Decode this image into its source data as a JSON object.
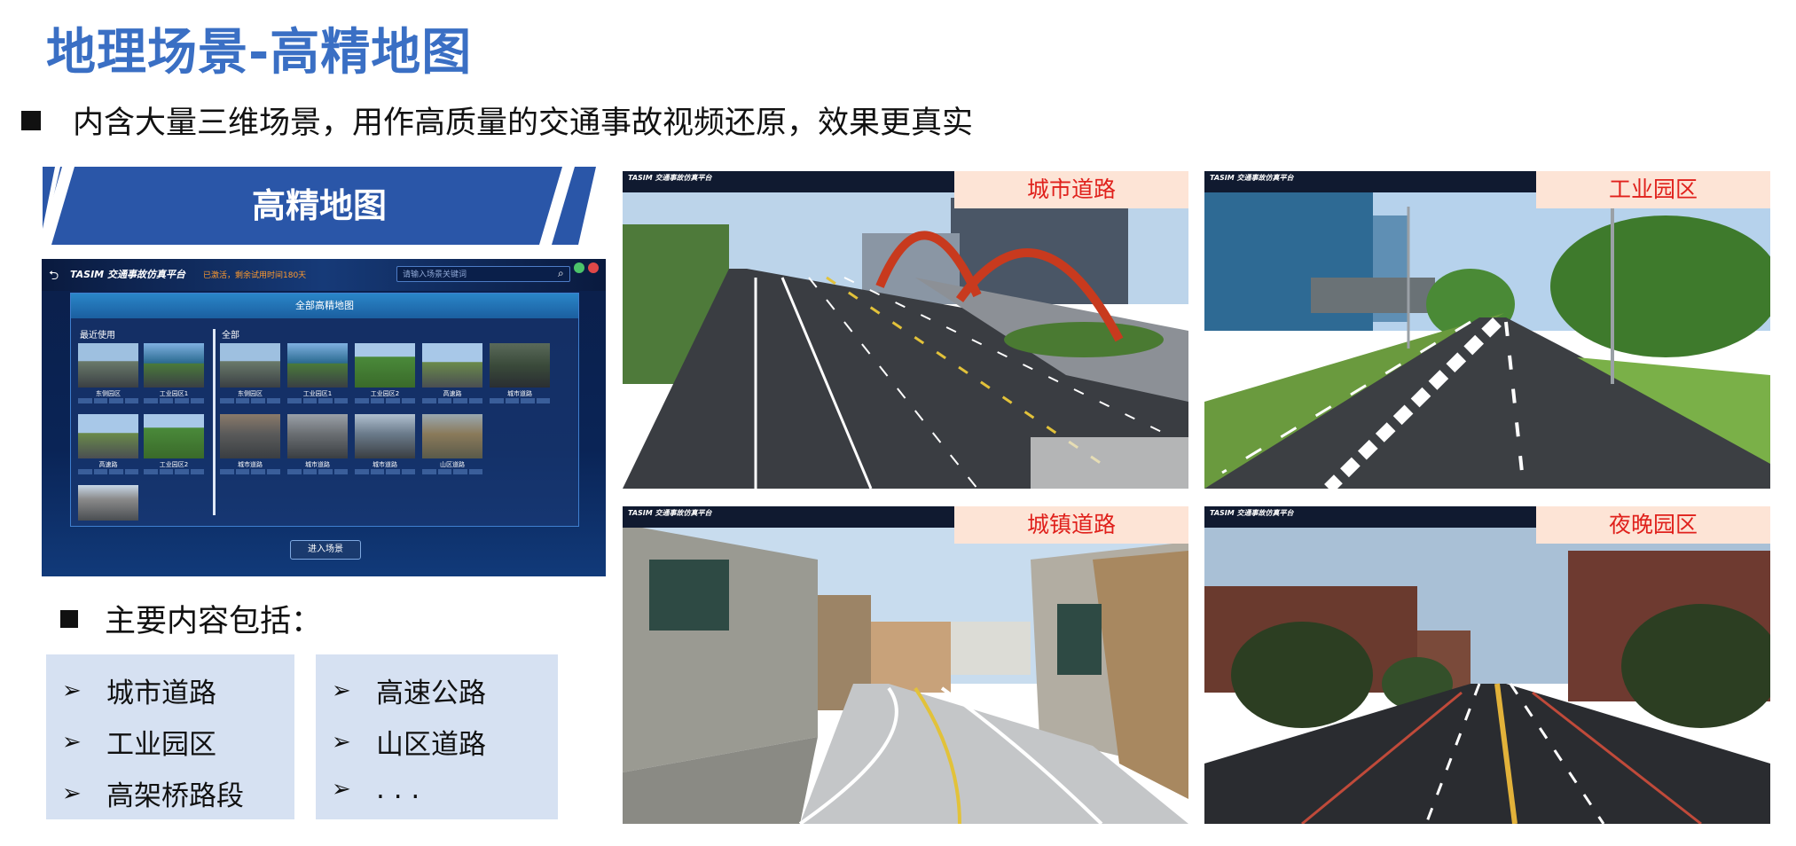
{
  "title": "地理场景-高精地图",
  "bullet_main": "内含大量三维场景，用作高质量的交通事故视频还原，效果更真实",
  "banner_title": "高精地图",
  "app": {
    "logo": "TASIM 交通事故仿真平台",
    "status": "已激活，剩余试用时间180天",
    "search_placeholder": "请输入场景关键词",
    "panel_title": "全部高精地图",
    "recent_label": "最近使用",
    "all_label": "全部",
    "recent_thumbs": [
      "东侧园区",
      "工业园区1",
      "高速路",
      "工业园区2",
      "城市道路"
    ],
    "all_thumbs": [
      "东侧园区",
      "工业园区1",
      "工业园区2",
      "高速路",
      "城市道路",
      "城市道路",
      "城市道路",
      "城市道路",
      "山区道路"
    ],
    "enter_button": "进入场景"
  },
  "contents_heading": "主要内容包括：",
  "contents_left": [
    "城市道路",
    "工业园区",
    "高架桥路段"
  ],
  "contents_right": [
    "高速公路",
    "山区道路",
    ". . ."
  ],
  "scenes": [
    {
      "label": "城市道路",
      "bar": "TASIM 交通事故仿真平台"
    },
    {
      "label": "工业园区",
      "bar": "TASIM 交通事故仿真平台"
    },
    {
      "label": "城镇道路",
      "bar": "TASIM 交通事故仿真平台"
    },
    {
      "label": "夜晚园区",
      "bar": "TASIM 交通事故仿真平台"
    }
  ]
}
